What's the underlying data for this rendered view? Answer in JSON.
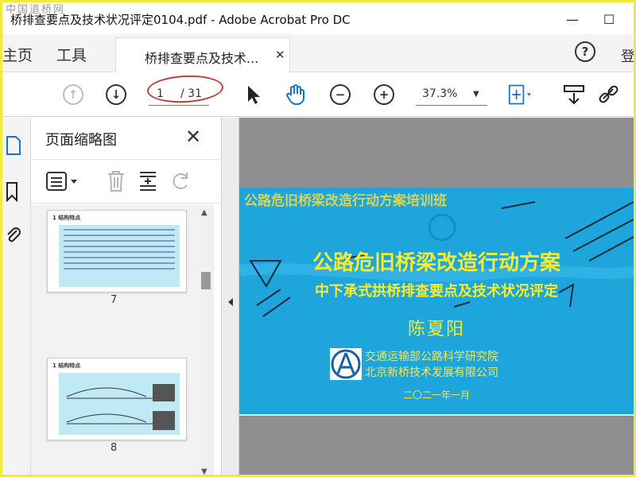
{
  "window": {
    "watermark": "中国道桥网",
    "title": "桥排查要点及技术状况评定0104.pdf - Adobe Acrobat Pro DC",
    "minimize": "—",
    "maximize": "☐"
  },
  "tabs": {
    "home": "主页",
    "tools": "工具",
    "document": "桥排查要点及技术...",
    "close": "✕",
    "help": "?",
    "login": "登"
  },
  "toolbar": {
    "page_current": "1",
    "page_total": "/ 31",
    "zoom": "37.3%",
    "zoom_arrow": "▼"
  },
  "thumbnails_panel": {
    "title": "页面缩略图",
    "close": "✕",
    "thumbs": [
      {
        "heading": "1 结构特点",
        "page": "7"
      },
      {
        "heading": "1 结构特点",
        "page": "8"
      }
    ]
  },
  "slide": {
    "banner": "公路危旧桥梁改造行动方案培训班",
    "title": "公路危旧桥梁改造行动方案",
    "subtitle": "中下承式拱桥排查要点及技术状况评定",
    "author": "陈夏阳",
    "org1": "交通运输部公路科学研究院",
    "org2": "北京新桥技术发展有限公司",
    "date": "二〇二一年一月"
  },
  "colors": {
    "slide_bg": "#1ea6dc",
    "slide_text": "#f8ec2c",
    "doc_bg": "#8f8f8f",
    "frame": "#f2ea3a",
    "annotation_oval": "#b0453a"
  }
}
